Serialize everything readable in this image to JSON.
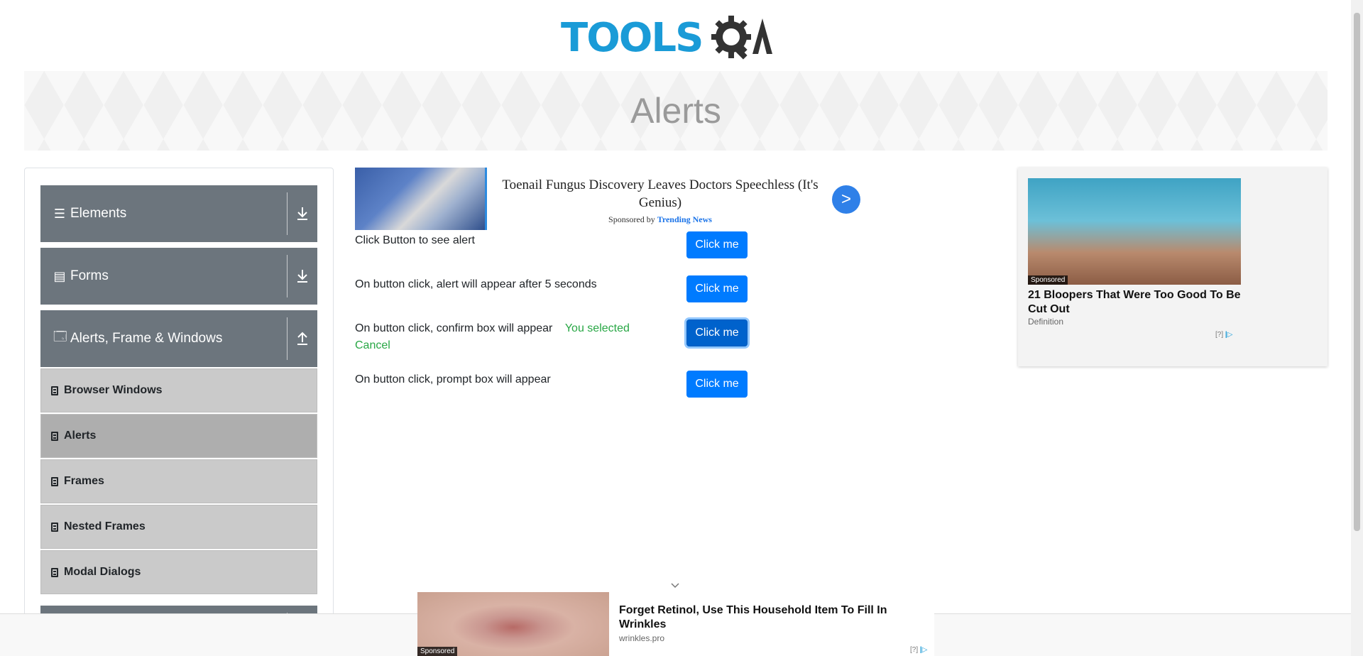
{
  "header": {
    "logo_text": "TOOLS",
    "logo_suffix": "A"
  },
  "banner": {
    "title": "Alerts"
  },
  "sidebar": {
    "groups": [
      {
        "label": "Elements",
        "icon": "hamburger-icon"
      },
      {
        "label": "Forms",
        "icon": "form-icon"
      },
      {
        "label": "Alerts, Frame & Windows",
        "icon": "window-icon"
      }
    ],
    "items": [
      {
        "label": "Browser Windows"
      },
      {
        "label": "Alerts"
      },
      {
        "label": "Frames"
      },
      {
        "label": "Nested Frames"
      },
      {
        "label": "Modal Dialogs"
      }
    ]
  },
  "ad_top": {
    "title": "Toenail Fungus Discovery Leaves Doctors Speechless (It's Genius)",
    "sponsor_prefix": "Sponsored by",
    "sponsor_name": "Trending News",
    "arrow": ">"
  },
  "alerts": [
    {
      "label": "Click Button to see alert",
      "button": "Click me"
    },
    {
      "label": "On button click, alert will appear after 5 seconds",
      "button": "Click me"
    },
    {
      "label": "On button click, confirm box will appear",
      "result": "You selected Cancel",
      "button": "Click me"
    },
    {
      "label": "On button click, prompt box will appear",
      "button": "Click me"
    }
  ],
  "ad_right": {
    "tag": "Sponsored",
    "title": "21 Bloopers That Were Too Good To Be Cut Out",
    "source": "Definition",
    "choices": "[?]"
  },
  "ad_bottom": {
    "tag": "Sponsored",
    "title": "Forget Retinol, Use This Household Item To Fill In Wrinkles",
    "source": "wrinkles.pro",
    "choices": "[?]"
  },
  "colors": {
    "primary": "#007bff",
    "sidebar_group": "#6c757d",
    "sidebar_item": "#cacaca",
    "success": "#28a745",
    "logo_blue": "#1a9bd7"
  }
}
